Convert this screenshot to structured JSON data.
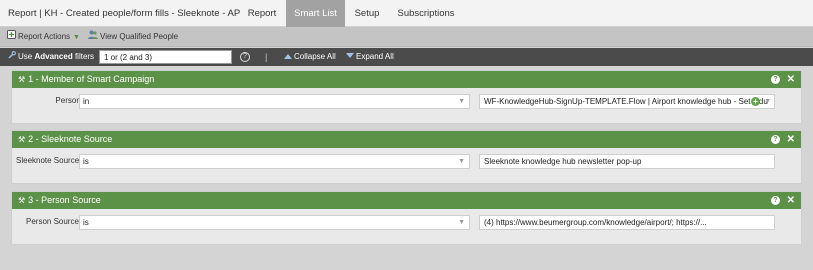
{
  "tabs": {
    "report_name": "Report | KH - Created people/form fills - Sleeknote - AP",
    "report": "Report",
    "smart_list": "Smart List",
    "setup": "Setup",
    "subscriptions": "Subscriptions",
    "active": "Smart List"
  },
  "actions": {
    "report_actions": "Report Actions",
    "view_qualified": "View Qualified People"
  },
  "filterbar": {
    "use_label": "Use",
    "advanced_label": "Advanced",
    "filters_label": "filters",
    "logic_value": "1 or (2 and 3)",
    "collapse_all": "Collapse All",
    "expand_all": "Expand All"
  },
  "filters": [
    {
      "title": "1 - Member of Smart Campaign",
      "field_label": "Person:",
      "operator": "in",
      "value": "WF-KnowledgeHub-SignUp-TEMPLATE.Flow | Airport knowledge hub - Set indu"
    },
    {
      "title": "2 - Sleeknote Source",
      "field_label": "Sleeknote Source:",
      "operator": "is",
      "value": "Sleeknote knowledge hub newsletter pop-up"
    },
    {
      "title": "3 - Person Source",
      "field_label": "Person Source:",
      "operator": "is",
      "value": "(4) https://www.beumergroup.com/knowledge/airport/; https://..."
    }
  ],
  "colors": {
    "panel_header": "#5c9148",
    "filterbar": "#4b4b4b",
    "active_tab": "#a2a2a2"
  }
}
